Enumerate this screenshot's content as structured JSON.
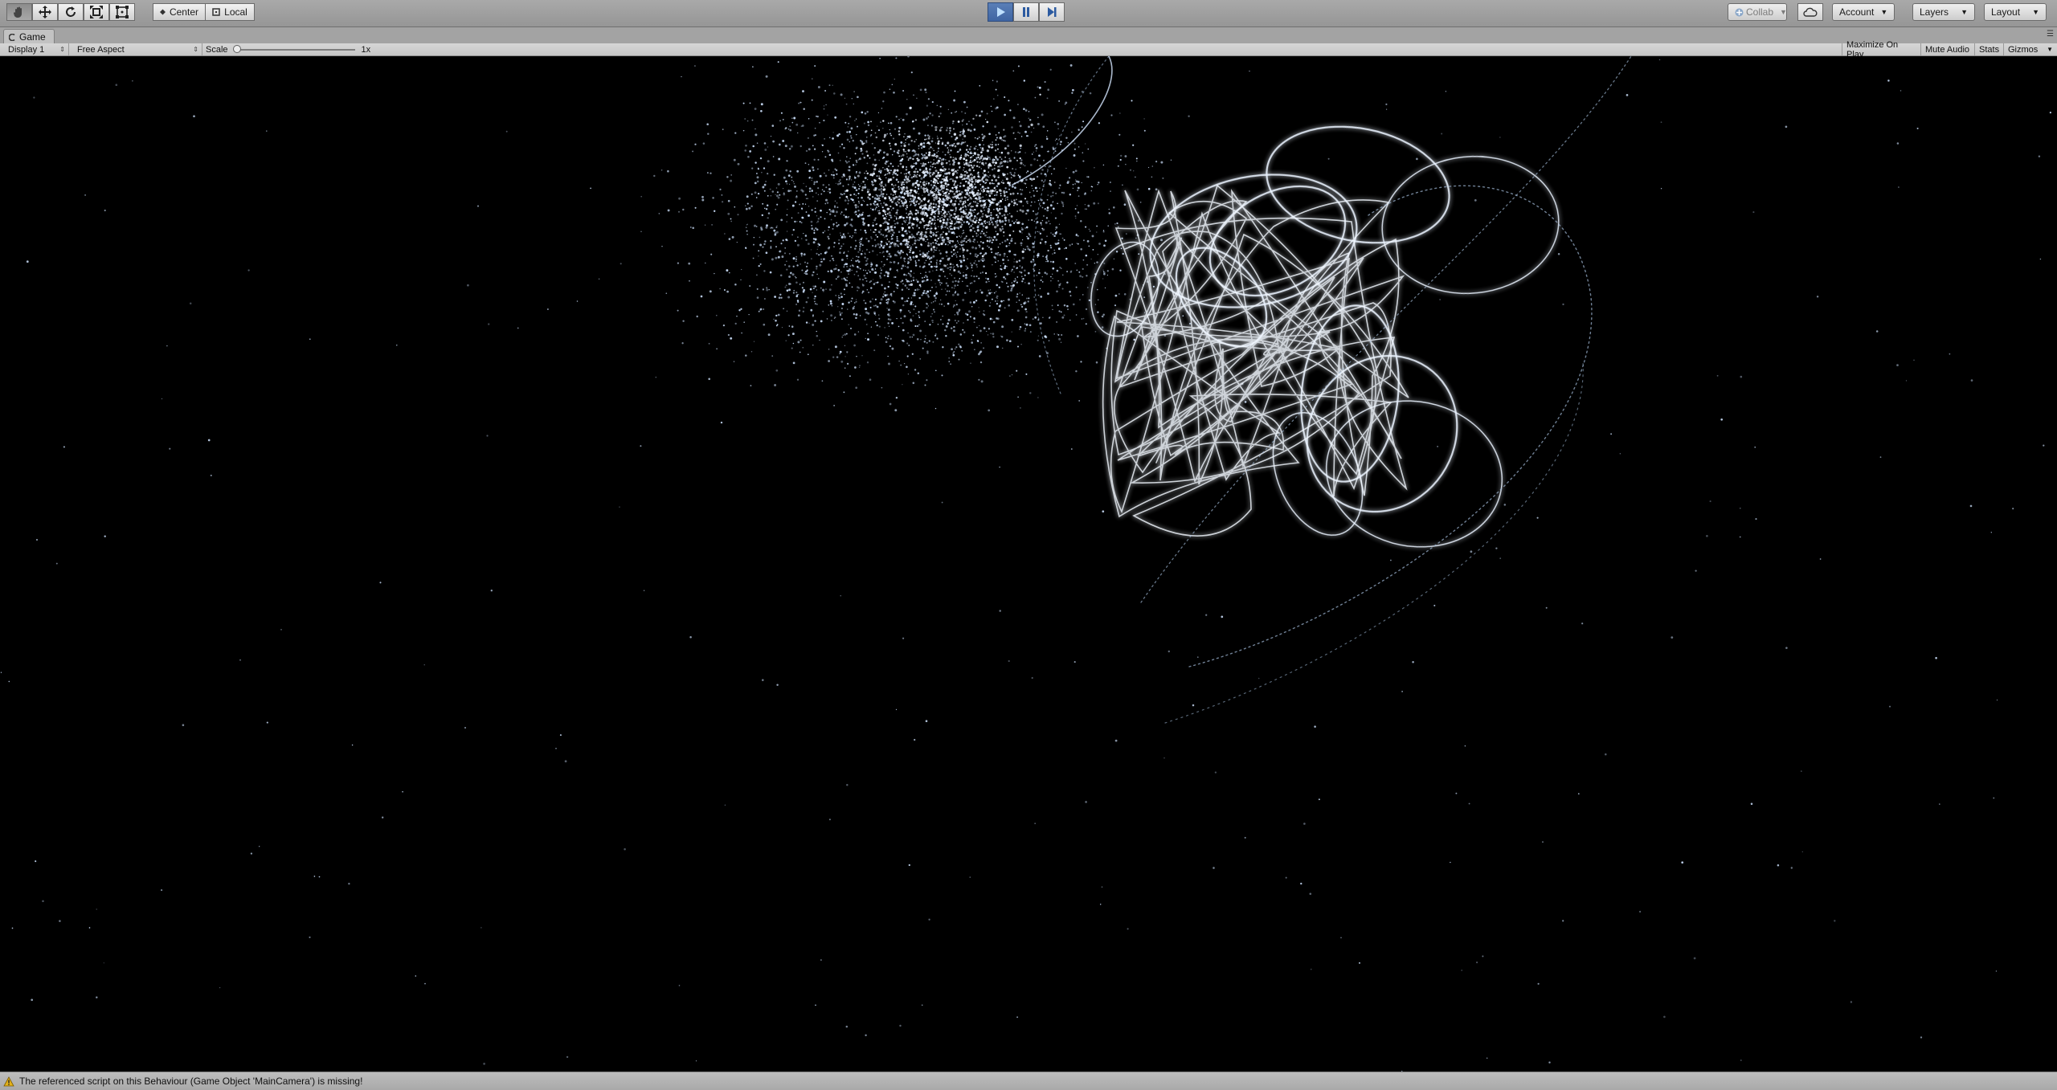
{
  "toolbar": {
    "tools": [
      "hand-tool",
      "move-tool",
      "rotate-tool",
      "scale-tool",
      "rect-tool"
    ],
    "pivot_mode": "Center",
    "pivot_rotation": "Local",
    "collab": "Collab",
    "account": "Account",
    "layers": "Layers",
    "layout": "Layout"
  },
  "tab": {
    "title": "Game"
  },
  "game_bar": {
    "display": "Display 1",
    "aspect": "Free Aspect",
    "scale_label": "Scale",
    "scale_value": "1x",
    "maximize_on_play": "Maximize On Play",
    "mute_audio": "Mute Audio",
    "stats": "Stats",
    "gizmos": "Gizmos"
  },
  "status": {
    "message": "The referenced script on this Behaviour (Game Object 'MainCamera') is missing!"
  },
  "colors": {
    "play_active": "#3f65a3",
    "particle": "#cfe3ff",
    "warning": "#e3b21a"
  }
}
